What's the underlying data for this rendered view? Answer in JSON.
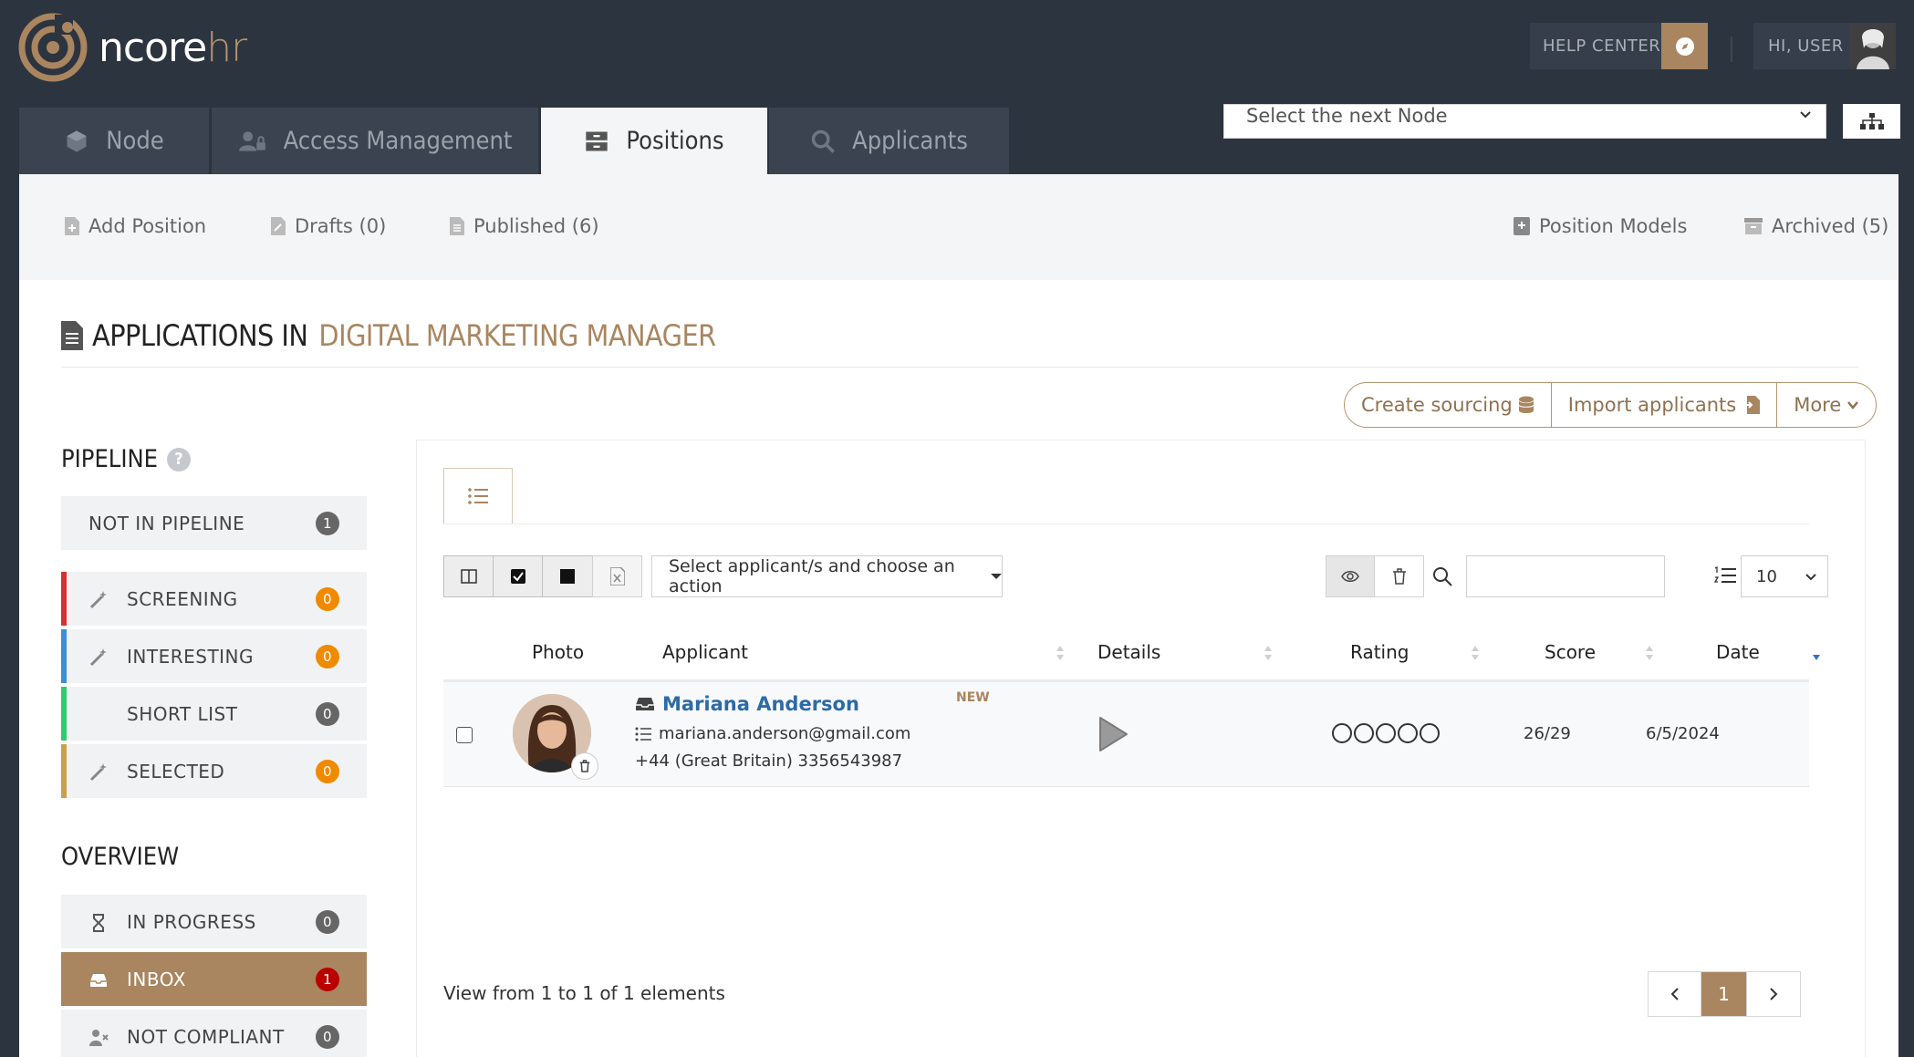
{
  "brand": {
    "name_main": "ncore",
    "name_accent": "hr",
    "accent_color": "#a98560"
  },
  "header": {
    "help_label": "HELP CENTER",
    "user_label": "HI, USER"
  },
  "tabs": [
    {
      "label": "Node"
    },
    {
      "label": "Access Management"
    },
    {
      "label": "Positions",
      "active": true
    },
    {
      "label": "Applicants"
    }
  ],
  "node_select": {
    "placeholder": "Select the next Node"
  },
  "subnav": {
    "add_position": "Add Position",
    "drafts": "Drafts (0)",
    "published": "Published (6)",
    "position_models": "Position Models",
    "archived": "Archived (5)"
  },
  "page": {
    "heading_prefix": "APPLICATIONS IN",
    "heading_position": "DIGITAL MARKETING MANAGER"
  },
  "actions": {
    "create_sourcing": "Create sourcing",
    "import_applicants": "Import applicants",
    "more": "More"
  },
  "pipeline": {
    "title": "PIPELINE",
    "items": [
      {
        "label": "NOT IN PIPELINE",
        "count": "1"
      },
      {
        "label": "SCREENING",
        "count": "0",
        "color": "#d63031"
      },
      {
        "label": "INTERESTING",
        "count": "0",
        "color": "#3a8fd6"
      },
      {
        "label": "SHORT LIST",
        "count": "0",
        "color": "#2ecc71"
      },
      {
        "label": "SELECTED",
        "count": "0",
        "color": "#c9a14a"
      }
    ]
  },
  "overview": {
    "title": "OVERVIEW",
    "items": [
      {
        "label": "IN PROGRESS",
        "count": "0"
      },
      {
        "label": "INBOX",
        "count": "1",
        "active": true
      },
      {
        "label": "NOT COMPLIANT",
        "count": "0"
      }
    ]
  },
  "toolbar": {
    "action_select": "Select applicant/s and choose an action",
    "search_value": "",
    "page_size": "10"
  },
  "table": {
    "headers": {
      "photo": "Photo",
      "applicant": "Applicant",
      "details": "Details",
      "rating": "Rating",
      "score": "Score",
      "date": "Date"
    },
    "rows": [
      {
        "name": "Mariana Anderson",
        "badge": "NEW",
        "email": "mariana.anderson@gmail.com",
        "phone": "+44 (Great Britain) 3356543987",
        "rating": 0,
        "score": "26/29",
        "date": "6/5/2024"
      }
    ]
  },
  "footer": {
    "view_from": "View from 1 to 1 of 1 elements",
    "current_page": "1"
  }
}
